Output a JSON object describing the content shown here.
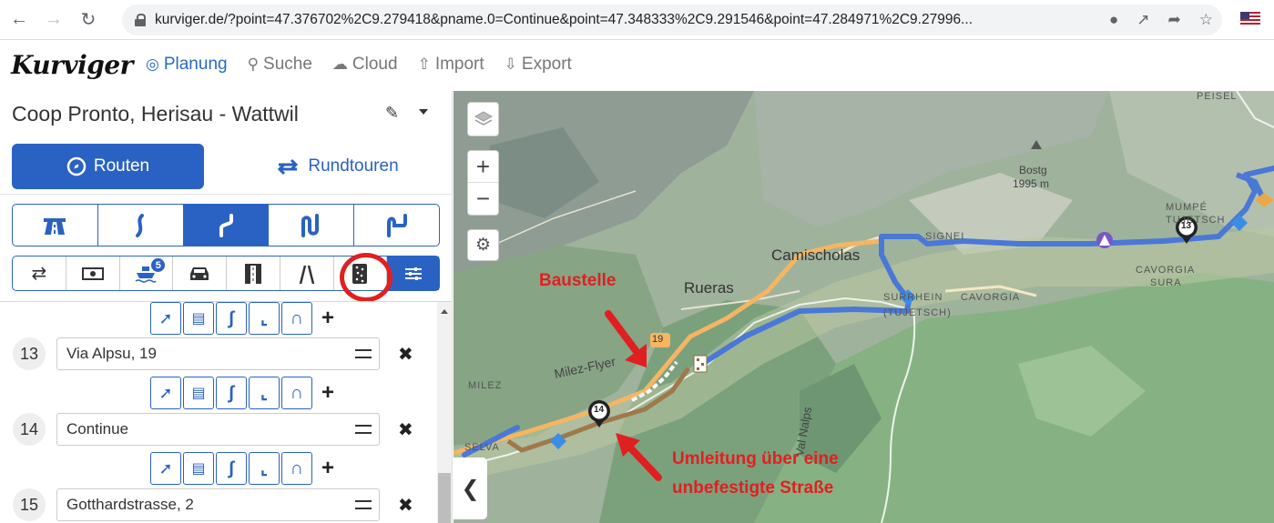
{
  "browser": {
    "url": "kurviger.de/?point=47.376702%2C9.279418&pname.0=Continue&point=47.348333%2C9.291546&point=47.284971%2C9.27996...",
    "back_icon": "arrow-left-icon",
    "forward_icon": "arrow-right-icon",
    "reload_icon": "reload-icon"
  },
  "app": {
    "logo": "Kurviger",
    "nav": [
      {
        "label": "Planung",
        "icon": "compass-icon",
        "active": true
      },
      {
        "label": "Suche",
        "icon": "search-icon"
      },
      {
        "label": "Cloud",
        "icon": "cloud-icon"
      },
      {
        "label": "Import",
        "icon": "upload-icon"
      },
      {
        "label": "Export",
        "icon": "download-icon"
      }
    ]
  },
  "sidebar": {
    "route_title": "Coop Pronto, Herisau - Wattwil",
    "tabs": {
      "routen": "Routen",
      "rundtouren": "Rundtouren"
    },
    "profiles": [
      "motorway",
      "slight-curvy",
      "curvy",
      "curviest",
      "extreme-curvy"
    ],
    "selected_profile_index": 2,
    "options": [
      "shuffle",
      "toll",
      "ferry",
      "car",
      "tunnel",
      "narrow",
      "unpaved",
      "settings"
    ],
    "ferry_badge": "5",
    "waypoints": [
      {
        "num": "13",
        "name": "Via Alpsu, 19"
      },
      {
        "num": "14",
        "name": "Continue"
      },
      {
        "num": "15",
        "name": "Gotthardstrasse, 2"
      }
    ]
  },
  "map": {
    "labels": {
      "peisel": "PEISEL",
      "bostg": "Bostg",
      "bostg_elev": "1995 m",
      "mumpe": "MUMPÉ",
      "tujetsch": "TUJETSCH",
      "camischolas": "Camischolas",
      "rueras": "Rueras",
      "cavorgia_sura_1": "CAVORGIA",
      "cavorgia_sura_2": "SURA",
      "cavorgia": "CAVORGIA",
      "surrein": "SURRHEIN",
      "tujetsch_paren": "(TUJETSCH)",
      "milez_flyer": "Milez-Flyer",
      "milez": "MILEZ",
      "selva": "SELVA",
      "nalps": "Val Nalps",
      "signei": "SIGNEI",
      "road_19": "19",
      "marker_13": "13",
      "marker_14": "14"
    },
    "annotations": {
      "baustelle": "Baustelle",
      "umleitung_1": "Umleitung über eine",
      "umleitung_2": "unbefestigte Straße"
    },
    "colors": {
      "route": "#4a78d6",
      "detour": "#a0784a",
      "annotation": "#e02020"
    }
  }
}
